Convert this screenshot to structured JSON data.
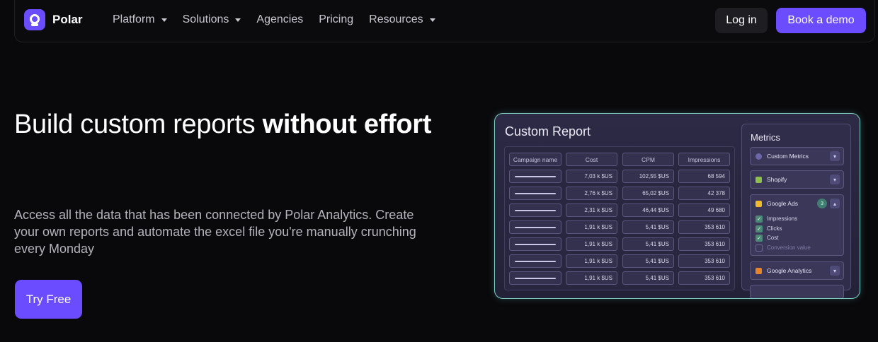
{
  "nav": {
    "brand": "Polar",
    "menu": [
      {
        "label": "Platform",
        "dropdown": true
      },
      {
        "label": "Solutions",
        "dropdown": true
      },
      {
        "label": "Agencies",
        "dropdown": false
      },
      {
        "label": "Pricing",
        "dropdown": false
      },
      {
        "label": "Resources",
        "dropdown": true
      }
    ],
    "login": "Log in",
    "demo": "Book a demo"
  },
  "hero": {
    "title_regular": "Build custom reports ",
    "title_bold": "without effort",
    "subtitle": "Access all the data that has been connected by Polar Analytics. Create your own reports and automate the excel file you're manually crunching every Monday",
    "cta": "Try Free"
  },
  "report": {
    "title": "Custom Report",
    "columns": [
      "Campaign name",
      "Cost",
      "CPM",
      "Impressions"
    ],
    "rows": [
      {
        "cost": "7,03 k $US",
        "cpm": "102,55 $US",
        "impressions": "68 594"
      },
      {
        "cost": "2,76 k $US",
        "cpm": "65,02 $US",
        "impressions": "42 378"
      },
      {
        "cost": "2,31 k $US",
        "cpm": "46,44 $US",
        "impressions": "49 680"
      },
      {
        "cost": "1,91 k $US",
        "cpm": "5,41 $US",
        "impressions": "353 610"
      },
      {
        "cost": "1,91 k $US",
        "cpm": "5,41 $US",
        "impressions": "353 610"
      },
      {
        "cost": "1,91 k $US",
        "cpm": "5,41 $US",
        "impressions": "353 610"
      },
      {
        "cost": "1,91 k $US",
        "cpm": "5,41 $US",
        "impressions": "353 610"
      }
    ],
    "metrics": {
      "title": "Metrics",
      "sources": [
        {
          "label": "Custom Metrics",
          "icon": "custom-metrics-icon"
        },
        {
          "label": "Shopify",
          "icon": "shopify-icon"
        },
        {
          "label": "Google Ads",
          "icon": "google-ads-icon",
          "badge": "3",
          "expanded": true,
          "options": [
            {
              "label": "Impressions",
              "checked": true
            },
            {
              "label": "Clicks",
              "checked": true
            },
            {
              "label": "Cost",
              "checked": true
            },
            {
              "label": "Conversion value",
              "checked": false
            }
          ]
        },
        {
          "label": "Google Analytics",
          "icon": "google-analytics-icon"
        }
      ]
    }
  },
  "colors": {
    "accent": "#6b4cff",
    "background": "#09090b",
    "card_border": "#7dd3c0"
  }
}
